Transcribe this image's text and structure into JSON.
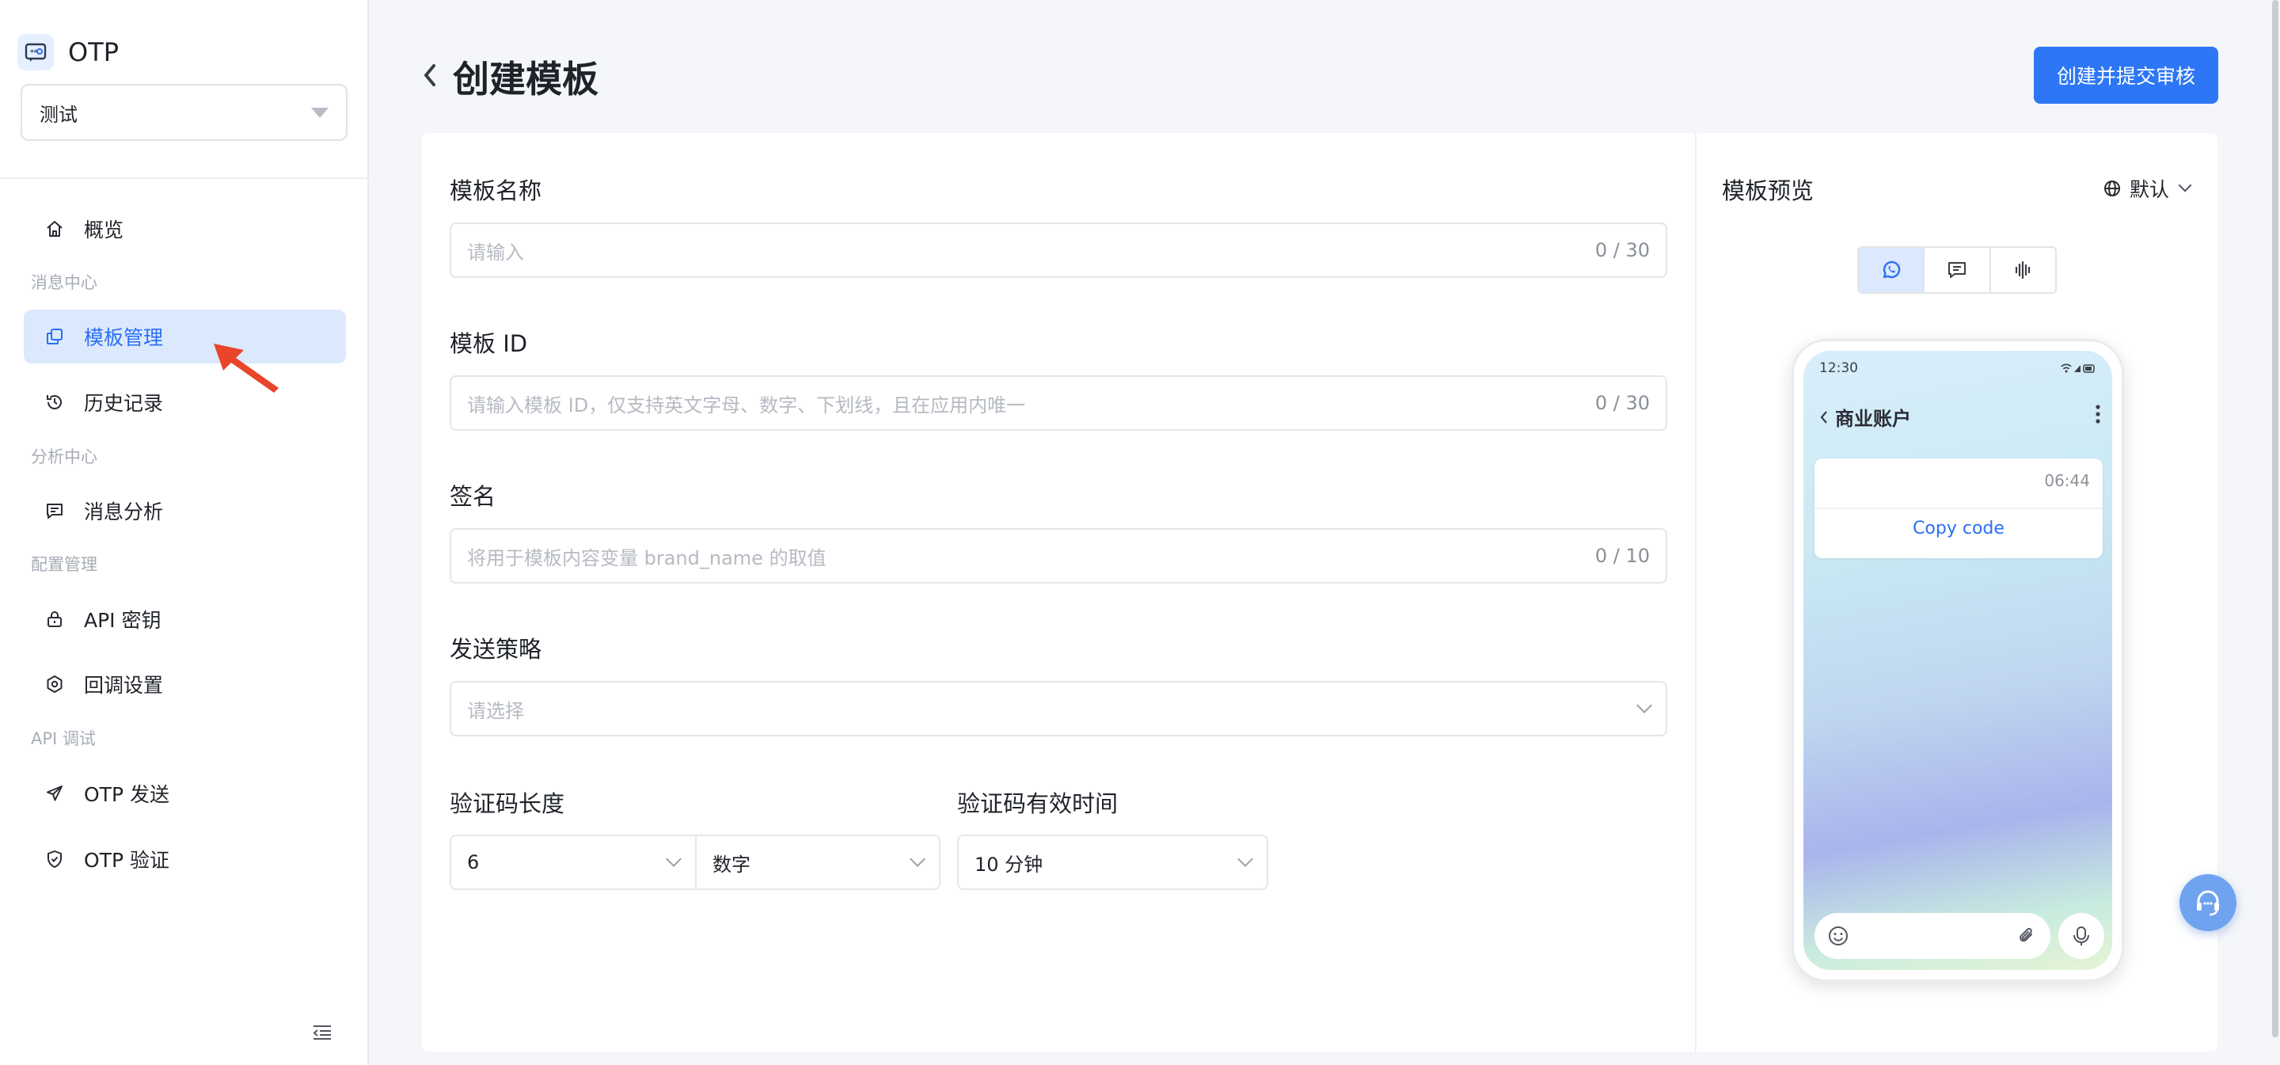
{
  "app": {
    "title": "OTP",
    "selected_app": "测试"
  },
  "sidebar": {
    "overview": "概览",
    "group_message": "消息中心",
    "templates": "模板管理",
    "history": "历史记录",
    "group_analysis": "分析中心",
    "message_analysis": "消息分析",
    "group_config": "配置管理",
    "api_key": "API 密钥",
    "callback": "回调设置",
    "group_api": "API 调试",
    "otp_send": "OTP 发送",
    "otp_verify": "OTP 验证",
    "active_item": "模板管理"
  },
  "header": {
    "title": "创建模板",
    "submit_label": "创建并提交审核"
  },
  "form": {
    "name": {
      "label": "模板名称",
      "placeholder": "请输入",
      "counter": "0 / 30"
    },
    "id": {
      "label": "模板 ID",
      "placeholder": "请输入模板 ID，仅支持英文字母、数字、下划线，且在应用内唯一",
      "counter": "0 / 30"
    },
    "signature": {
      "label": "签名",
      "placeholder": "将用于模板内容变量 brand_name 的取值",
      "counter": "0 / 10"
    },
    "strategy": {
      "label": "发送策略",
      "placeholder": "请选择"
    },
    "code_length": {
      "label": "验证码长度",
      "length_value": "6",
      "type_value": "数字"
    },
    "validity": {
      "label": "验证码有效时间",
      "value": "10 分钟"
    }
  },
  "preview": {
    "title": "模板预览",
    "language": "默认",
    "channels": [
      "whatsapp-icon",
      "sms-icon",
      "voice-icon"
    ],
    "active_channel": "whatsapp",
    "phone": {
      "time": "12:30",
      "chat_title": "商业账户",
      "message_time": "06:44",
      "button_label": "Copy code"
    }
  },
  "colors": {
    "accent": "#2d77f6",
    "active_bg": "#dce9fd",
    "pointer": "#e8452c"
  }
}
